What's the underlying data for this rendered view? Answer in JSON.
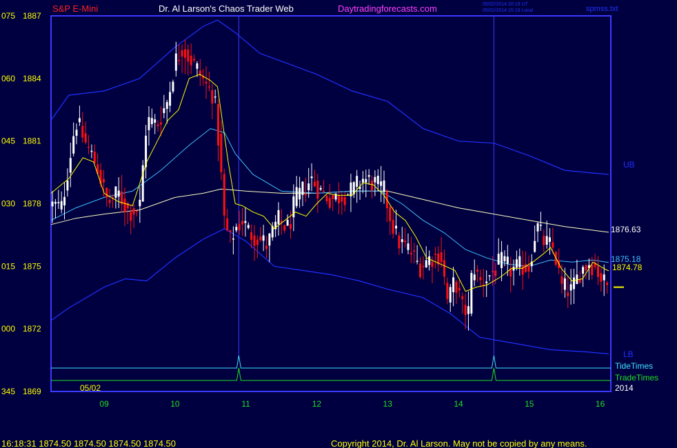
{
  "header": {
    "symbol": "S&P E-Mini",
    "site_title": "Dr. Al Larson's Chaos Trader Web",
    "site_url": "Daytradingforecasts.com",
    "timestamp_utc": "05/02/2014 20:19 UT",
    "timestamp_local": "05/02/2014 15:19 Local",
    "file_name": "spmss.txt"
  },
  "footer": {
    "quote_line": "16:18:31  1874.50 1874.50 1874.50 1874.50",
    "copyright": "Copyright 2014, Dr. Al Larson. May not be copied by any means."
  },
  "chart_data": {
    "type": "candlestick",
    "title": "S&P E-Mini",
    "date_label": "05/02",
    "year_label": "2014",
    "x_ticks": [
      "09",
      "10",
      "11",
      "12",
      "13",
      "14",
      "15",
      "16"
    ],
    "y_ticks": [
      {
        "left": "075",
        "price": "1887"
      },
      {
        "left": "060",
        "price": "1884"
      },
      {
        "left": "045",
        "price": "1881"
      },
      {
        "left": "030",
        "price": "1878"
      },
      {
        "left": "015",
        "price": "1875"
      },
      {
        "left": "000",
        "price": "1872"
      },
      {
        "left": "345",
        "price": "1869"
      }
    ],
    "ylim": [
      1869,
      1887
    ],
    "xlim": [
      8.25,
      16.15
    ],
    "colors": {
      "background": "#000040",
      "frame": "#3b3bff",
      "up_candle": "#ffffff",
      "down_candle": "#ff1010",
      "ma_fast": "#ffff00",
      "ma_mid": "#40c0ff",
      "ma_slow": "#ffffc0",
      "bands": "#2030ff",
      "tide_times": "#40e0ff",
      "trade_times": "#20e020",
      "tick_labels": "#ffff00",
      "time_labels": "#20e020"
    },
    "labels": {
      "ub": "UB",
      "lb": "LB",
      "tide_times": "TideTimes",
      "trade_times": "TradeTimes",
      "ma_slow_value": "1876.63",
      "ma_mid_value": "1875.18",
      "ma_fast_value": "1874.78"
    },
    "timing_marks": [
      10.9,
      14.5
    ],
    "anchors": [
      [
        8.25,
        1877.95
      ],
      [
        8.4,
        1877.8
      ],
      [
        8.6,
        1882.0
      ],
      [
        8.75,
        1880.8
      ],
      [
        8.9,
        1879.8
      ],
      [
        9.05,
        1878.0
      ],
      [
        9.2,
        1878.5
      ],
      [
        9.35,
        1877.6
      ],
      [
        9.5,
        1877.8
      ],
      [
        9.6,
        1882.0
      ],
      [
        9.75,
        1881.8
      ],
      [
        9.9,
        1883.0
      ],
      [
        10.0,
        1884.8
      ],
      [
        10.1,
        1885.5
      ],
      [
        10.3,
        1884.5
      ],
      [
        10.45,
        1883.6
      ],
      [
        10.55,
        1883.2
      ],
      [
        10.62,
        1880.8
      ],
      [
        10.7,
        1877.0
      ],
      [
        10.78,
        1876.2
      ],
      [
        10.85,
        1876.8
      ],
      [
        10.95,
        1877.2
      ],
      [
        11.05,
        1876.6
      ],
      [
        11.15,
        1876.4
      ],
      [
        11.3,
        1876.0
      ],
      [
        11.45,
        1877.2
      ],
      [
        11.6,
        1876.8
      ],
      [
        11.7,
        1878.2
      ],
      [
        11.8,
        1878.6
      ],
      [
        11.92,
        1879.2
      ],
      [
        12.05,
        1878.6
      ],
      [
        12.2,
        1878.2
      ],
      [
        12.35,
        1878.4
      ],
      [
        12.5,
        1878.6
      ],
      [
        12.65,
        1879.2
      ],
      [
        12.8,
        1879.0
      ],
      [
        12.95,
        1878.6
      ],
      [
        13.05,
        1877.2
      ],
      [
        13.15,
        1876.2
      ],
      [
        13.3,
        1875.8
      ],
      [
        13.45,
        1875.0
      ],
      [
        13.6,
        1875.4
      ],
      [
        13.75,
        1875.6
      ],
      [
        13.85,
        1873.2
      ],
      [
        13.95,
        1874.4
      ],
      [
        14.05,
        1873.0
      ],
      [
        14.15,
        1872.8
      ],
      [
        14.2,
        1875.2
      ],
      [
        14.3,
        1874.2
      ],
      [
        14.45,
        1874.6
      ],
      [
        14.6,
        1875.2
      ],
      [
        14.75,
        1874.8
      ],
      [
        14.9,
        1875.0
      ],
      [
        15.0,
        1875.0
      ],
      [
        15.05,
        1876.0
      ],
      [
        15.1,
        1877.0
      ],
      [
        15.2,
        1876.2
      ],
      [
        15.35,
        1875.8
      ],
      [
        15.45,
        1874.0
      ],
      [
        15.6,
        1873.8
      ],
      [
        15.72,
        1874.8
      ],
      [
        15.85,
        1875.2
      ],
      [
        15.95,
        1874.9
      ],
      [
        16.05,
        1874.2
      ],
      [
        16.12,
        1874.0
      ]
    ],
    "ma_fast": [
      [
        8.25,
        1878.5
      ],
      [
        8.5,
        1879.2
      ],
      [
        8.7,
        1880.2
      ],
      [
        8.85,
        1880.0
      ],
      [
        9.0,
        1878.5
      ],
      [
        9.2,
        1878.1
      ],
      [
        9.4,
        1877.9
      ],
      [
        9.6,
        1880.0
      ],
      [
        9.75,
        1881.0
      ],
      [
        9.9,
        1882.0
      ],
      [
        10.05,
        1882.5
      ],
      [
        10.2,
        1884.0
      ],
      [
        10.35,
        1884.2
      ],
      [
        10.5,
        1883.9
      ],
      [
        10.6,
        1883.6
      ],
      [
        10.75,
        1880.0
      ],
      [
        10.85,
        1878.0
      ],
      [
        10.95,
        1877.9
      ],
      [
        11.1,
        1877.6
      ],
      [
        11.25,
        1877.4
      ],
      [
        11.4,
        1876.8
      ],
      [
        11.55,
        1877.2
      ],
      [
        11.7,
        1877.6
      ],
      [
        11.85,
        1877.4
      ],
      [
        12.0,
        1878.0
      ],
      [
        12.15,
        1878.5
      ],
      [
        12.3,
        1878.4
      ],
      [
        12.5,
        1878.4
      ],
      [
        12.65,
        1879.0
      ],
      [
        12.8,
        1878.9
      ],
      [
        12.95,
        1878.4
      ],
      [
        13.1,
        1877.6
      ],
      [
        13.25,
        1877.2
      ],
      [
        13.4,
        1876.4
      ],
      [
        13.55,
        1875.4
      ],
      [
        13.75,
        1875.1
      ],
      [
        13.95,
        1874.8
      ],
      [
        14.1,
        1873.8
      ],
      [
        14.25,
        1874.0
      ],
      [
        14.4,
        1874.1
      ],
      [
        14.6,
        1874.5
      ],
      [
        14.75,
        1874.9
      ],
      [
        14.9,
        1874.9
      ],
      [
        15.05,
        1875.2
      ],
      [
        15.2,
        1875.6
      ],
      [
        15.3,
        1875.9
      ],
      [
        15.45,
        1874.9
      ],
      [
        15.6,
        1874.3
      ],
      [
        15.75,
        1874.4
      ],
      [
        15.9,
        1875.2
      ],
      [
        16.05,
        1874.9
      ],
      [
        16.12,
        1874.78
      ]
    ],
    "ma_mid": [
      [
        8.25,
        1877.2
      ],
      [
        8.6,
        1877.8
      ],
      [
        9.0,
        1878.3
      ],
      [
        9.4,
        1878.6
      ],
      [
        9.8,
        1879.6
      ],
      [
        10.2,
        1880.8
      ],
      [
        10.5,
        1881.6
      ],
      [
        10.7,
        1881.4
      ],
      [
        10.85,
        1880.4
      ],
      [
        11.1,
        1879.4
      ],
      [
        11.5,
        1878.6
      ],
      [
        12.0,
        1878.5
      ],
      [
        12.5,
        1878.6
      ],
      [
        12.9,
        1878.6
      ],
      [
        13.2,
        1878.0
      ],
      [
        13.5,
        1877.2
      ],
      [
        13.8,
        1876.6
      ],
      [
        14.1,
        1875.8
      ],
      [
        14.4,
        1875.4
      ],
      [
        14.7,
        1875.1
      ],
      [
        15.0,
        1875.0
      ],
      [
        15.3,
        1875.3
      ],
      [
        15.6,
        1875.2
      ],
      [
        15.9,
        1875.3
      ],
      [
        16.12,
        1875.18
      ]
    ],
    "ma_slow": [
      [
        8.25,
        1877.0
      ],
      [
        8.6,
        1877.3
      ],
      [
        9.0,
        1877.5
      ],
      [
        9.5,
        1877.7
      ],
      [
        10.0,
        1878.3
      ],
      [
        10.4,
        1878.5
      ],
      [
        10.65,
        1878.7
      ],
      [
        11.0,
        1878.6
      ],
      [
        11.5,
        1878.5
      ],
      [
        12.0,
        1878.5
      ],
      [
        12.5,
        1878.6
      ],
      [
        13.0,
        1878.6
      ],
      [
        13.5,
        1878.2
      ],
      [
        14.0,
        1877.8
      ],
      [
        14.5,
        1877.5
      ],
      [
        15.0,
        1877.2
      ],
      [
        15.5,
        1876.9
      ],
      [
        16.12,
        1876.63
      ]
    ],
    "upper_band": [
      [
        8.25,
        1882.0
      ],
      [
        8.5,
        1883.2
      ],
      [
        9.0,
        1883.4
      ],
      [
        9.5,
        1884.0
      ],
      [
        10.0,
        1885.5
      ],
      [
        10.4,
        1886.5
      ],
      [
        10.6,
        1886.8
      ],
      [
        10.85,
        1886.2
      ],
      [
        11.2,
        1885.2
      ],
      [
        11.6,
        1884.7
      ],
      [
        12.0,
        1884.2
      ],
      [
        12.5,
        1883.4
      ],
      [
        13.0,
        1882.9
      ],
      [
        13.5,
        1881.6
      ],
      [
        14.0,
        1881.0
      ],
      [
        14.5,
        1880.9
      ],
      [
        15.0,
        1880.3
      ],
      [
        15.5,
        1879.6
      ],
      [
        15.8,
        1879.5
      ],
      [
        16.12,
        1879.4
      ]
    ],
    "lower_band": [
      [
        8.25,
        1872.4
      ],
      [
        8.5,
        1873.0
      ],
      [
        9.0,
        1874.0
      ],
      [
        9.3,
        1874.4
      ],
      [
        9.6,
        1874.3
      ],
      [
        10.0,
        1875.4
      ],
      [
        10.4,
        1876.3
      ],
      [
        10.7,
        1876.8
      ],
      [
        11.0,
        1876.2
      ],
      [
        11.4,
        1875.0
      ],
      [
        11.8,
        1874.8
      ],
      [
        12.2,
        1874.6
      ],
      [
        12.6,
        1874.3
      ],
      [
        13.0,
        1873.9
      ],
      [
        13.5,
        1873.5
      ],
      [
        13.9,
        1872.7
      ],
      [
        14.3,
        1871.6
      ],
      [
        14.8,
        1871.3
      ],
      [
        15.3,
        1871.0
      ],
      [
        15.8,
        1870.9
      ],
      [
        16.12,
        1870.8
      ]
    ],
    "bar_count": 185
  }
}
